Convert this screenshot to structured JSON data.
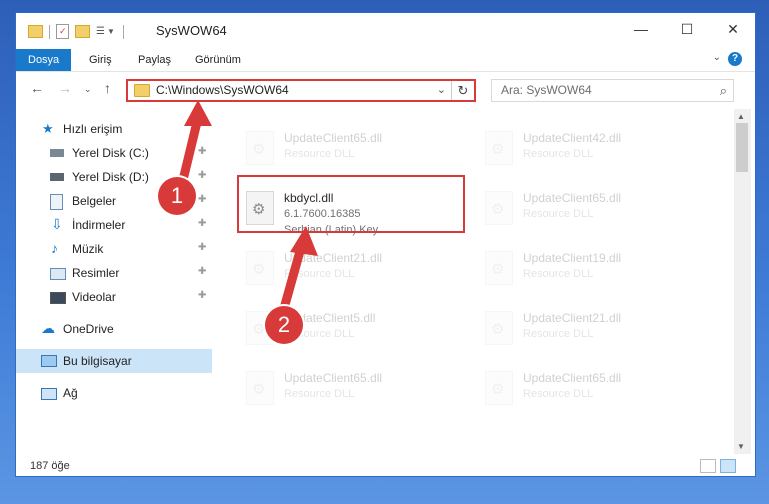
{
  "window": {
    "title": "SysWOW64",
    "controls": {
      "minimize": "—",
      "maximize": "☐",
      "close": "✕"
    }
  },
  "ribbon": {
    "tabs": [
      "Dosya",
      "Giriş",
      "Paylaş",
      "Görünüm"
    ],
    "help": "?"
  },
  "nav": {
    "address": "C:\\Windows\\SysWOW64",
    "search_placeholder": "Ara: SysWOW64"
  },
  "sidebar": {
    "items": [
      {
        "label": "Hızlı erişim",
        "icon": "star-icon"
      },
      {
        "label": "Yerel Disk (C:)",
        "icon": "drive-icon"
      },
      {
        "label": "Yerel Disk (D:)",
        "icon": "drive-icon"
      },
      {
        "label": "Belgeler",
        "icon": "documents-icon"
      },
      {
        "label": "İndirmeler",
        "icon": "download-icon"
      },
      {
        "label": "Müzik",
        "icon": "music-icon"
      },
      {
        "label": "Resimler",
        "icon": "pictures-icon"
      },
      {
        "label": "Videolar",
        "icon": "videos-icon"
      },
      {
        "label": "OneDrive",
        "icon": "cloud-icon"
      },
      {
        "label": "Bu bilgisayar",
        "icon": "computer-icon"
      },
      {
        "label": "Ağ",
        "icon": "network-icon"
      }
    ]
  },
  "files": {
    "left": [
      {
        "name": "UpdateClient65.dll",
        "desc": "Resource DLL"
      },
      {
        "name": "UpdateClient21.dll",
        "desc": "Resource DLL"
      },
      {
        "name": "UpdateClient5.dll",
        "desc": "Resource DLL"
      },
      {
        "name": "UpdateClient65.dll",
        "desc": "Resource DLL"
      }
    ],
    "right": [
      {
        "name": "UpdateClient42.dll",
        "desc": "Resource DLL"
      },
      {
        "name": "UpdateClient65.dll",
        "desc": "Resource DLL"
      },
      {
        "name": "UpdateClient19.dll",
        "desc": "Resource DLL"
      },
      {
        "name": "UpdateClient21.dll",
        "desc": "Resource DLL"
      },
      {
        "name": "UpdateClient65.dll",
        "desc": "Resource DLL"
      }
    ],
    "main": {
      "name": "kbdycl.dll",
      "version": "6.1.7600.16385",
      "desc": "Serbian (Latin) Key..."
    }
  },
  "status": {
    "count": "187 öğe"
  },
  "annotations": {
    "step1": "1",
    "step2": "2",
    "color": "#d83a3a"
  }
}
